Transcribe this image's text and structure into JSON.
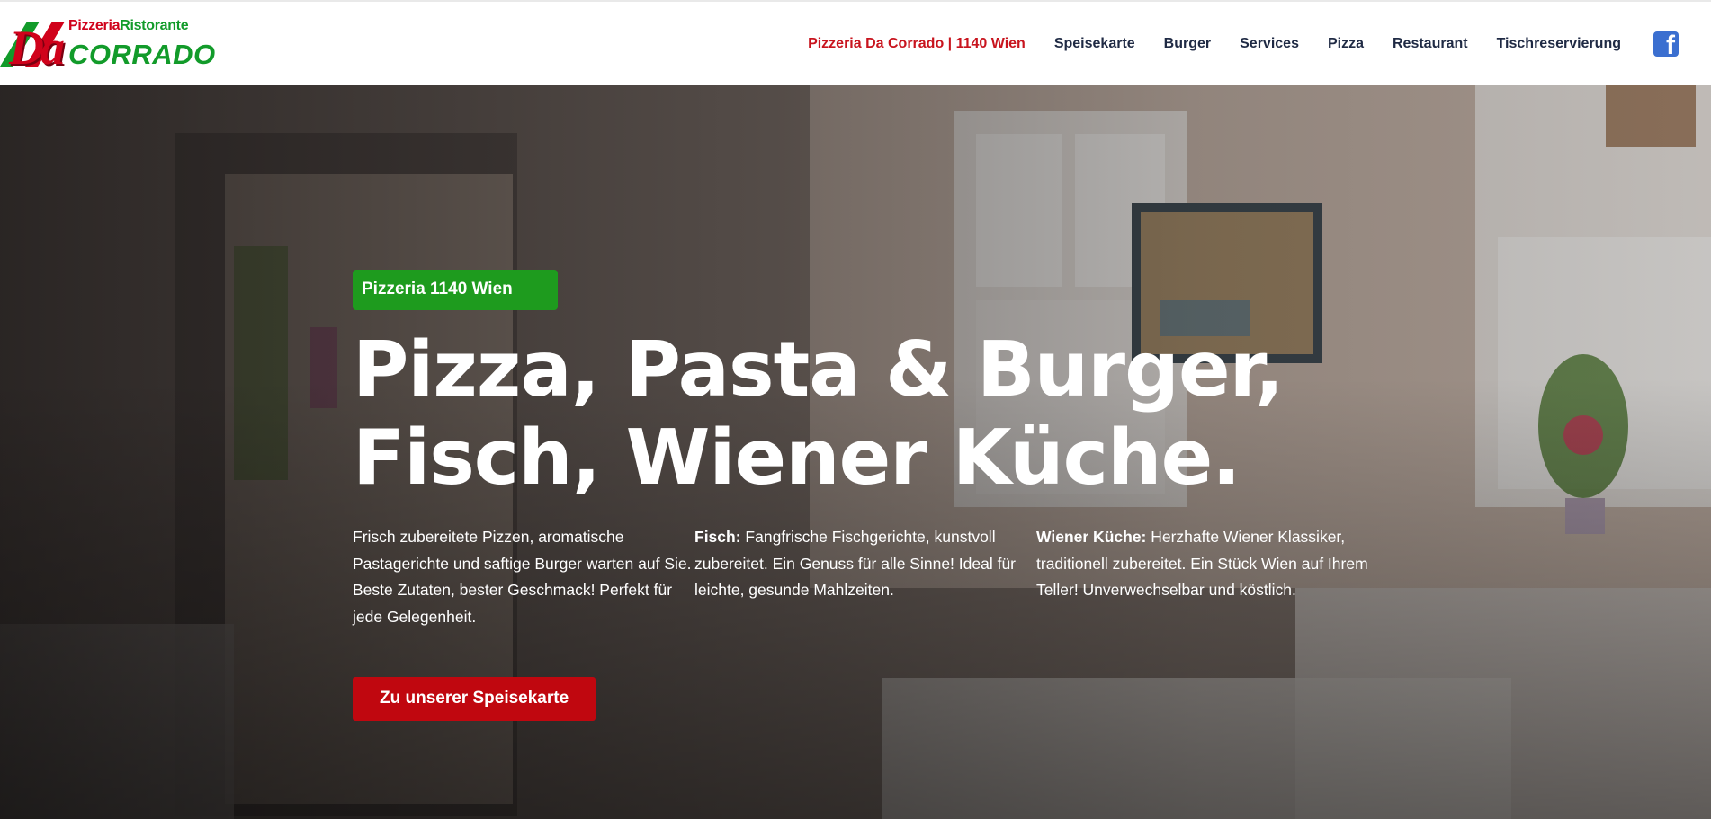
{
  "header": {
    "logo": {
      "line1_a": "Pizzeria",
      "line1_b": "Ristorante",
      "da": "Da",
      "name": "CORRADO"
    },
    "nav": [
      {
        "label": "Pizzeria Da Corrado | 1140 Wien",
        "active": true
      },
      {
        "label": "Speisekarte"
      },
      {
        "label": "Burger"
      },
      {
        "label": "Services"
      },
      {
        "label": "Pizza"
      },
      {
        "label": "Restaurant"
      },
      {
        "label": "Tischreservierung"
      }
    ],
    "social_icon": "facebook-icon",
    "social_glyph": "f"
  },
  "hero": {
    "badge": "Pizzeria 1140 Wien",
    "headline_line1": "Pizza, Pasta & Burger,",
    "headline_line2": "Fisch, Wiener Küche.",
    "columns": [
      {
        "lead": "",
        "text": "Frisch zubereitete Pizzen, aromatische Pastagerichte und saftige Burger warten auf Sie. Beste Zutaten, bester Geschmack! Perfekt für jede Gelegenheit."
      },
      {
        "lead": "Fisch:",
        "text": " Fangfrische Fischgerichte, kunstvoll zubereitet. Ein Genuss für alle Sinne! Ideal für leichte, gesunde Mahlzeiten."
      },
      {
        "lead": "Wiener Küche:",
        "text": " Herzhafte Wiener Klassiker, traditionell zubereitet. Ein Stück Wien auf Ihrem Teller! Unverwechselbar und köstlich."
      }
    ],
    "cta": "Zu unserer Speisekarte"
  },
  "colors": {
    "accent_red": "#c0070f",
    "nav_active": "#c8141e",
    "badge_green": "#1e9b1e",
    "nav_text": "#1f2a44",
    "facebook": "#3b6fd0"
  }
}
